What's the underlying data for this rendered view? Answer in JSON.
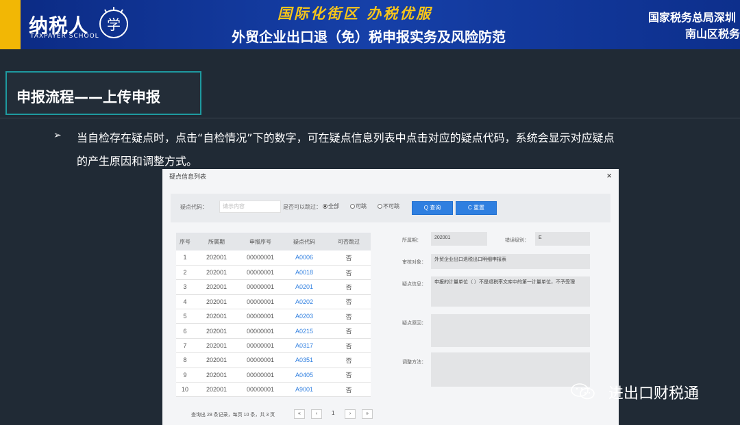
{
  "header": {
    "logo_text": "纳税人",
    "logo_sub": "TAXPAYER SCHOOL",
    "slogan": "国际化街区 办税优服",
    "title": "外贸企业出口退（免）税申报实务及风险防范",
    "org_line1": "国家税务总局深圳",
    "org_line2": "南山区税务",
    "colors": {
      "banner": "#1640a8",
      "accent": "#f2b705",
      "slogan": "#f7c51a"
    }
  },
  "section": {
    "title": "申报流程——上传申报",
    "bullet": "➢",
    "para_line1": "当自检存在疑点时，点击“自检情况”下的数字，可在疑点信息列表中点击对应的疑点代码，系统会显示对应疑点",
    "para_line2": "的产生原因和调整方式。"
  },
  "dialog": {
    "title": "疑点信息列表",
    "close": "×",
    "filter": {
      "code_label": "疑点代码：",
      "code_placeholder": "请示内容",
      "pass_label": "是否可以跳过：",
      "radios": [
        {
          "label": "全部",
          "checked": true
        },
        {
          "label": "可跳",
          "checked": false
        },
        {
          "label": "不可跳",
          "checked": false
        }
      ],
      "search_button": "Q 查询",
      "reset_button": "C 重置"
    },
    "table": {
      "headers": [
        "序号",
        "所属期",
        "申报序号",
        "疑点代码",
        "可否跳过"
      ],
      "rows": [
        [
          "1",
          "202001",
          "00000001",
          "A0006",
          "否"
        ],
        [
          "2",
          "202001",
          "00000001",
          "A0018",
          "否"
        ],
        [
          "3",
          "202001",
          "00000001",
          "A0201",
          "否"
        ],
        [
          "4",
          "202001",
          "00000001",
          "A0202",
          "否"
        ],
        [
          "5",
          "202001",
          "00000001",
          "A0203",
          "否"
        ],
        [
          "6",
          "202001",
          "00000001",
          "A0215",
          "否"
        ],
        [
          "7",
          "202001",
          "00000001",
          "A0317",
          "否"
        ],
        [
          "8",
          "202001",
          "00000001",
          "A0351",
          "否"
        ],
        [
          "9",
          "202001",
          "00000001",
          "A0405",
          "否"
        ],
        [
          "10",
          "202001",
          "00000001",
          "A9001",
          "否"
        ]
      ]
    },
    "pager": {
      "text": "查询出 28 条记录，每页 10 条，共 3 页",
      "first": "«",
      "prev": "‹",
      "current": "1",
      "next": "›",
      "last": "»"
    },
    "detail": {
      "period_label": "所属期：",
      "period_value": "202001",
      "level_label": "错误级别：",
      "level_value": "E",
      "object_label": "审核对象：",
      "object_value": "外贸企业出口退税出口明细申报表",
      "info_label": "疑点信息：",
      "info_value": "申报的计量单位（ ）不是退税率文库中的第一计量单位，不予受理",
      "reason_label": "疑点原因：",
      "reason_value": "",
      "method_label": "调整方法：",
      "method_value": ""
    }
  },
  "watermark": {
    "icon": "wechat-icon",
    "text": "进出口财税通"
  }
}
